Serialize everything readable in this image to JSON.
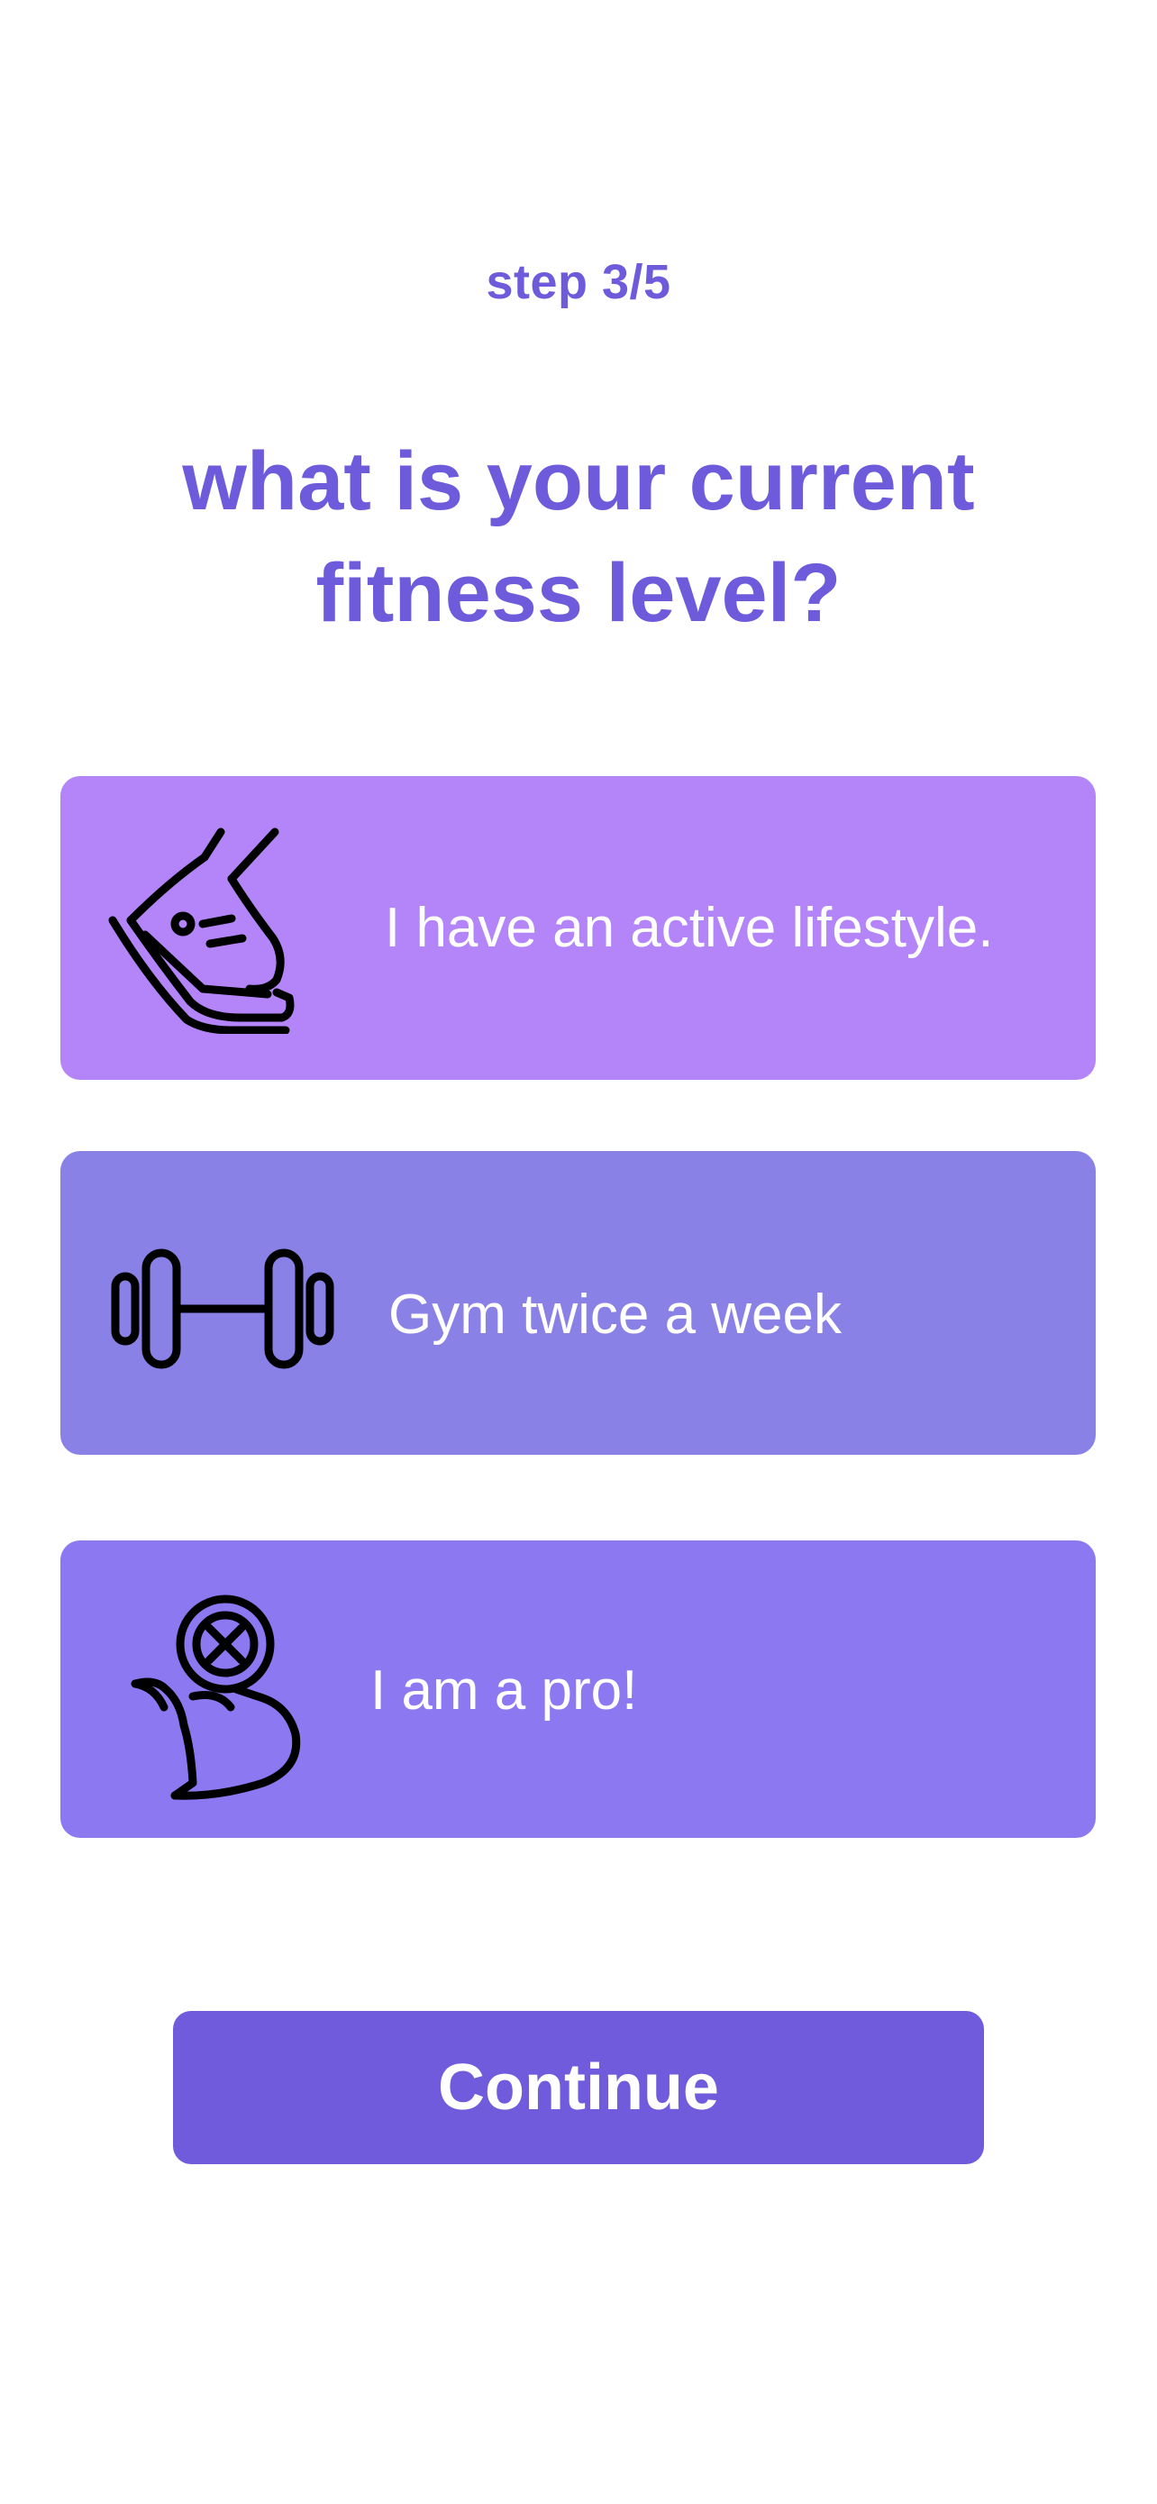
{
  "header": {
    "step": "step 3/5",
    "title_line1": "what is your current",
    "title_line2": "fitness level?"
  },
  "options": [
    {
      "label": "I have an active lifestyle.",
      "icon": "sneaker-icon",
      "color": "#b385f8"
    },
    {
      "label": "Gym twice a week",
      "icon": "dumbbell-icon",
      "color": "#8981e6"
    },
    {
      "label": "I am a pro!",
      "icon": "muscle-arm-icon",
      "color": "#8c79f2"
    }
  ],
  "footer": {
    "continue_label": "Continue"
  },
  "colors": {
    "accent": "#6d5bdc",
    "background": "#ffffff",
    "button": "#6f5bdb"
  }
}
